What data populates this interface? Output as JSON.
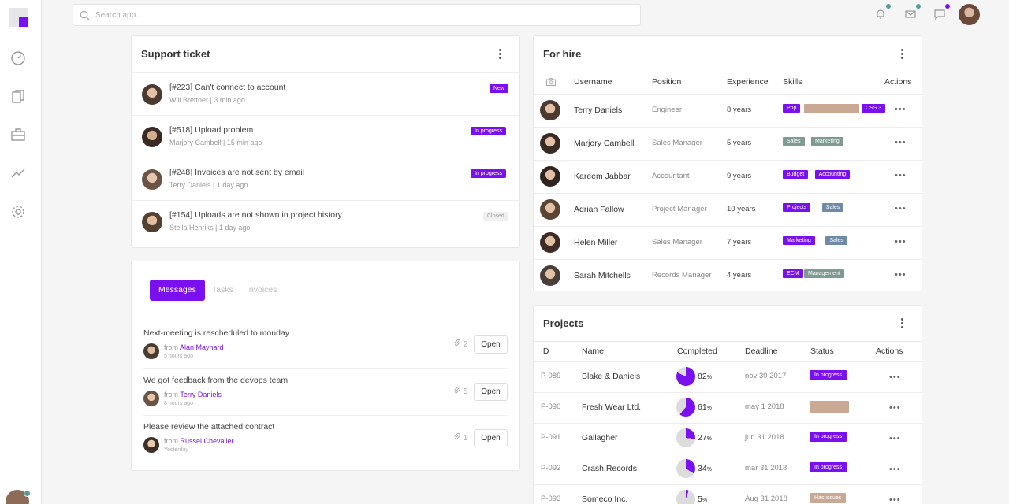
{
  "search": {
    "placeholder": "Search app..."
  },
  "colors": {
    "accent": "#7a10f0",
    "teal": "#5a9b8f",
    "grey_tag": "#7e9a92",
    "tan": "#c9a994",
    "blue_tag": "#6f8aa6"
  },
  "sidebar": {
    "icons": [
      "logo",
      "speedometer-icon",
      "documents-icon",
      "briefcase-icon",
      "trend-chart-icon",
      "gear-icon"
    ]
  },
  "support": {
    "title": "Support ticket",
    "tickets": [
      {
        "title": "[#223] Can't connect to account",
        "meta": "Will Brettner | 3 min ago",
        "status": "New"
      },
      {
        "title": "[#518] Upload problem",
        "meta": "Marjory Cambell | 15 min ago",
        "status": "In progress"
      },
      {
        "title": "[#248] Invoices are not sent by email",
        "meta": "Terry Daniels | 1 day ago",
        "status": "In progress"
      },
      {
        "title": "[#154] Uploads are not shown in project history",
        "meta": "Stella Henriks | 1 day ago",
        "status": "Closed"
      }
    ]
  },
  "messages": {
    "tabs": [
      "Messages",
      "Tasks",
      "Invoices"
    ],
    "from_label": "from",
    "open_label": "Open",
    "items": [
      {
        "text": "Next-meeting is rescheduled to monday",
        "sender": "Alan Maynard",
        "time": "5 hours ago",
        "attachments": "2"
      },
      {
        "text": "We got feedback from the devops team",
        "sender": "Terry Daniels",
        "time": "8 hours ago",
        "attachments": "5"
      },
      {
        "text": "Please review the attached contract",
        "sender": "Russel Chevalier",
        "time": "Yesterday",
        "attachments": "1"
      }
    ]
  },
  "hire": {
    "title": "For hire",
    "columns": [
      "Username",
      "Position",
      "Experience",
      "Skills",
      "Actions"
    ],
    "rows": [
      {
        "name": "Terry Daniels",
        "position": "Engineer",
        "experience": "8 years",
        "skills": [
          "Php",
          "",
          "CSS 3"
        ]
      },
      {
        "name": "Marjory Cambell",
        "position": "Sales Manager",
        "experience": "5 years",
        "skills": [
          "Sales",
          "Marketing"
        ]
      },
      {
        "name": "Kareem Jabbar",
        "position": "Accountant",
        "experience": "9 years",
        "skills": [
          "Budget",
          "Accounting"
        ]
      },
      {
        "name": "Adrian Fallow",
        "position": "Project Manager",
        "experience": "10 years",
        "skills": [
          "Projects",
          "Sales"
        ]
      },
      {
        "name": "Helen Miller",
        "position": "Sales Manager",
        "experience": "7 years",
        "skills": [
          "Marketing",
          "Sales"
        ]
      },
      {
        "name": "Sarah Mitchells",
        "position": "Records Manager",
        "experience": "4 years",
        "skills": [
          "ECM",
          "Management"
        ]
      }
    ]
  },
  "projects": {
    "title": "Projects",
    "columns": [
      "ID",
      "Name",
      "Completed",
      "Deadline",
      "Status",
      "Actions"
    ],
    "rows": [
      {
        "id": "P-089",
        "name": "Blake & Daniels",
        "completed": 82,
        "deadline": "nov 30 2017",
        "status": "In progress"
      },
      {
        "id": "P-090",
        "name": "Fresh Wear Ltd.",
        "completed": 61,
        "deadline": "may 1 2018",
        "status": ""
      },
      {
        "id": "P-091",
        "name": "Gallagher",
        "completed": 27,
        "deadline": "jun 31 2018",
        "status": "In progress"
      },
      {
        "id": "P-092",
        "name": "Crash Records",
        "completed": 34,
        "deadline": "mar 31 2018",
        "status": "In progress"
      },
      {
        "id": "P-093",
        "name": "Someco Inc.",
        "completed": 5,
        "deadline": "Aug 31 2018",
        "status": "Has issues"
      }
    ]
  }
}
